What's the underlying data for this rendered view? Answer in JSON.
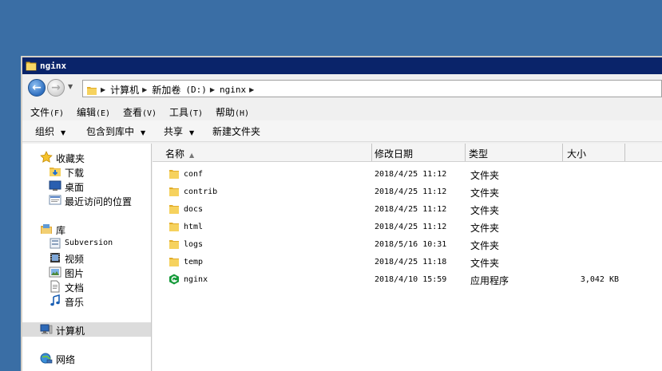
{
  "window": {
    "title": "nginx"
  },
  "address": {
    "crumbs": [
      "计算机",
      "新加卷",
      "(D:)",
      "nginx"
    ]
  },
  "menubar": {
    "items": [
      {
        "label": "文件",
        "hotkey": "(F)"
      },
      {
        "label": "编辑",
        "hotkey": "(E)"
      },
      {
        "label": "查看",
        "hotkey": "(V)"
      },
      {
        "label": "工具",
        "hotkey": "(T)"
      },
      {
        "label": "帮助",
        "hotkey": "(H)"
      }
    ]
  },
  "toolbar": {
    "organize": "组织",
    "include_library": "包含到库中",
    "share": "共享",
    "new_folder": "新建文件夹"
  },
  "nav": {
    "favorites": "收藏夹",
    "downloads": "下载",
    "desktop": "桌面",
    "recent": "最近访问的位置",
    "libraries": "库",
    "subversion": "Subversion",
    "videos": "视频",
    "pictures": "图片",
    "documents": "文档",
    "music": "音乐",
    "computer": "计算机",
    "network": "网络"
  },
  "columns": {
    "name": "名称",
    "modified": "修改日期",
    "type": "类型",
    "size": "大小"
  },
  "files": [
    {
      "name": "conf",
      "modified": "2018/4/25 11:12",
      "type": "文件夹",
      "size": "",
      "icon": "folder-icon"
    },
    {
      "name": "contrib",
      "modified": "2018/4/25 11:12",
      "type": "文件夹",
      "size": "",
      "icon": "folder-icon"
    },
    {
      "name": "docs",
      "modified": "2018/4/25 11:12",
      "type": "文件夹",
      "size": "",
      "icon": "folder-icon"
    },
    {
      "name": "html",
      "modified": "2018/4/25 11:12",
      "type": "文件夹",
      "size": "",
      "icon": "folder-icon"
    },
    {
      "name": "logs",
      "modified": "2018/5/16 10:31",
      "type": "文件夹",
      "size": "",
      "icon": "folder-icon"
    },
    {
      "name": "temp",
      "modified": "2018/4/25 11:18",
      "type": "文件夹",
      "size": "",
      "icon": "folder-icon"
    },
    {
      "name": "nginx",
      "modified": "2018/4/10 15:59",
      "type": "应用程序",
      "size": "3,042 KB",
      "icon": "nginx-app-icon"
    }
  ]
}
